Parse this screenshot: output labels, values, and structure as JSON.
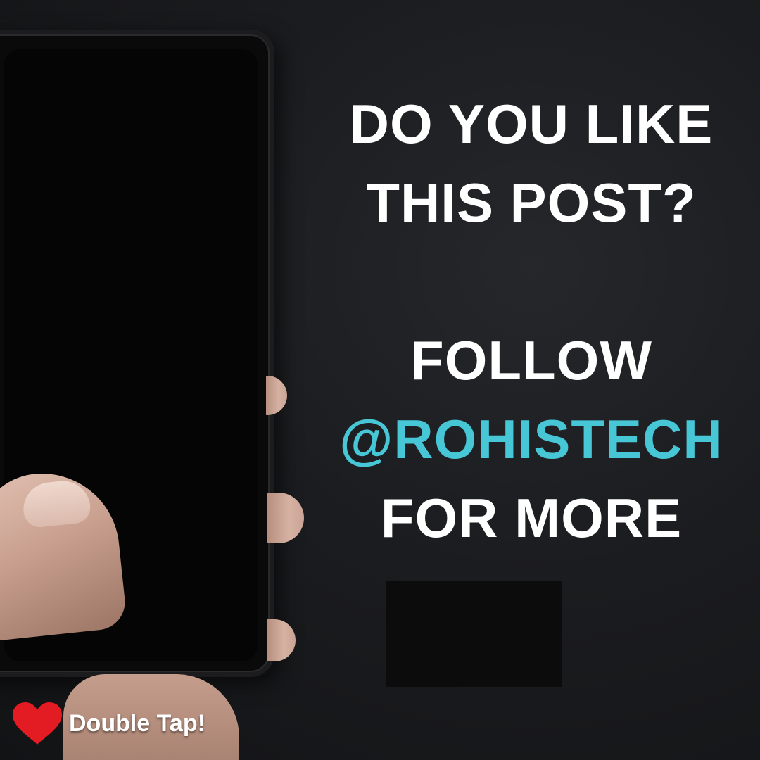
{
  "headline": {
    "question_line1": "DO YOU LIKE",
    "question_line2": "THIS POST?",
    "follow": "FOLLOW",
    "handle": "@ROHISTECH",
    "for_more": "FOR MORE"
  },
  "badge": {
    "label": "Double Tap!",
    "icon": "heart-icon"
  },
  "colors": {
    "text": "#ffffff",
    "accent": "#47c7d6",
    "heart": "#e31b23",
    "background": "#1b1c1f"
  }
}
